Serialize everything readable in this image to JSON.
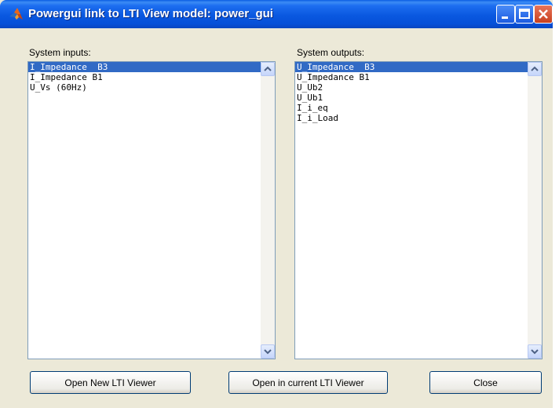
{
  "window": {
    "title": "Powergui link to LTI View model: power_gui"
  },
  "inputs": {
    "label": "System inputs:",
    "items": [
      "I_Impedance  B3",
      "I_Impedance B1",
      "U_Vs (60Hz)"
    ],
    "selected_index": 0
  },
  "outputs": {
    "label": "System outputs:",
    "items": [
      "U_Impedance  B3",
      "U_Impedance B1",
      "U_Ub2",
      "U_Ub1",
      "I_i_eq",
      "I_i_Load"
    ],
    "selected_index": 0
  },
  "buttons": {
    "open_new": "Open New LTI Viewer",
    "open_current": "Open in current LTI Viewer",
    "close": "Close"
  },
  "colors": {
    "selection": "#316ac5",
    "dialog_bg": "#ece9d8",
    "titlebar": "#0a58e0"
  }
}
